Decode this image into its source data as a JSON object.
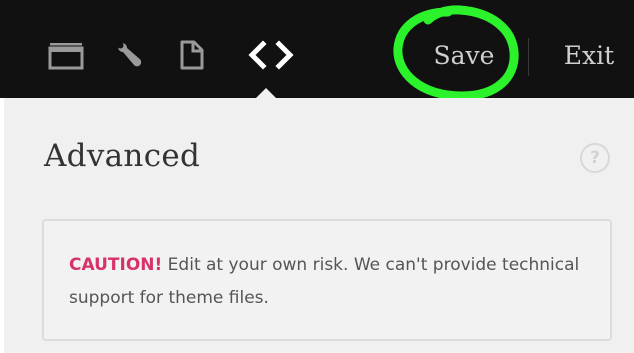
{
  "toolbar": {
    "icons": [
      "layout-icon",
      "wrench-icon",
      "page-icon",
      "code-icon"
    ],
    "save_label": "Save",
    "exit_label": "Exit",
    "annotation_color": "#2bf22b",
    "background": "#111111"
  },
  "panel": {
    "title": "Advanced",
    "help_symbol": "?",
    "caution": {
      "label": "CAUTION!",
      "message": " Edit at your own risk. We can't provide technical support for theme files.",
      "label_color": "#d6336c"
    }
  }
}
